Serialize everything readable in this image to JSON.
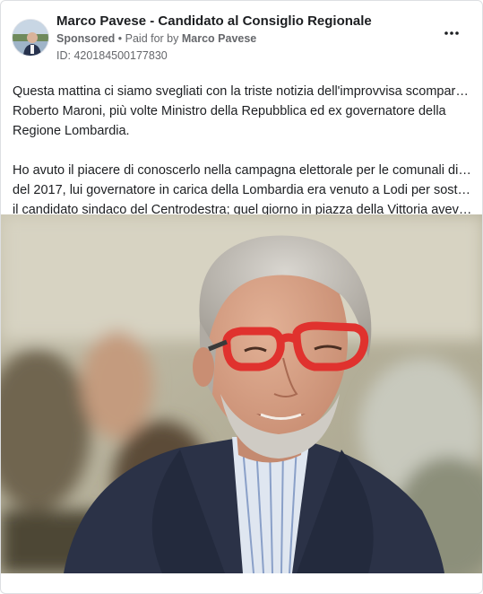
{
  "post": {
    "page_name": "Marco Pavese - Candidato al Consiglio Regionale",
    "sponsored_label": "Sponsored",
    "separator": " • ",
    "paid_for_label": "Paid for by ",
    "paid_for_name": "Marco Pavese",
    "ad_id": "ID: 420184500177830",
    "more_icon": "more-horizontal-icon",
    "paragraph_1_line_1": "Questa mattina ci siamo svegliati con la triste notizia dell'improvvisa scomparsa di",
    "paragraph_1_line_2": "Roberto Maroni, più volte Ministro della Repubblica ed ex governatore della",
    "paragraph_1_line_3": "Regione Lombardia.",
    "paragraph_2_line_1": "Ho avuto il piacere di conoscerlo nella campagna elettorale per le comunali di Lodi",
    "paragraph_2_line_2": "del 2017, lui governatore in carica della Lombardia era venuto a Lodi per sostenere",
    "paragraph_2_line_3": "il candidato sindaco del Centrodestra; quel giorno in piazza della Vittoria avevam..."
  },
  "colors": {
    "text": "#1c1e21",
    "secondary_text": "#65676b",
    "glasses": "#e0322e",
    "jacket": "#2b3247"
  }
}
